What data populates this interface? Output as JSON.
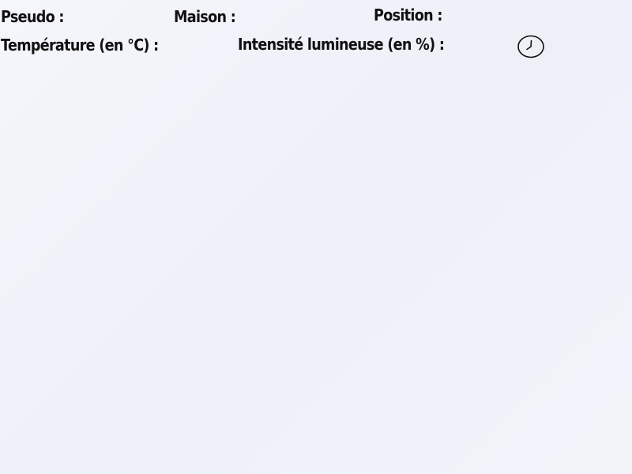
{
  "labels": {
    "pseudo": "Pseudo :",
    "maison": "Maison :",
    "position": "Position :",
    "temperature": "Température (en °C) :",
    "intensite": "Intensité lumineuse (en %) :"
  },
  "icons": {
    "clock": "clock-icon"
  },
  "colors": {
    "background": "#eef0f8",
    "text": "#111111"
  }
}
